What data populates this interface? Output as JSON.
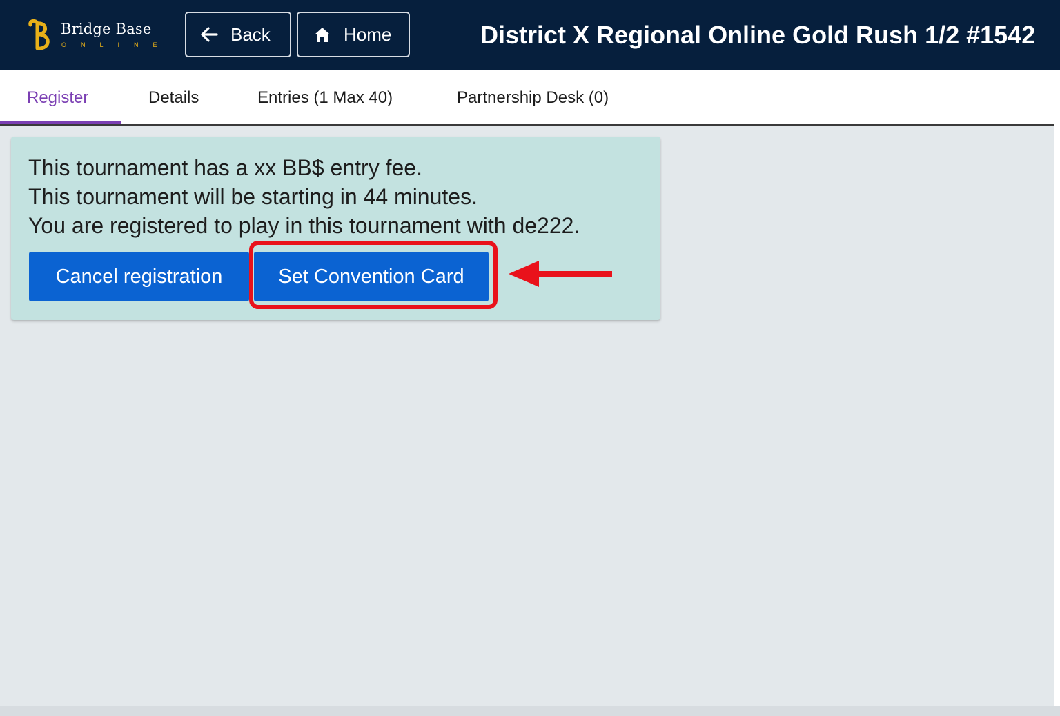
{
  "header": {
    "logo": {
      "name": "Bridge Base",
      "sub": "ONLINE",
      "mark_color": "#e8b019"
    },
    "back_label": "Back",
    "home_label": "Home",
    "title": "District X Regional Online Gold Rush 1/2 #1542",
    "background": "#061f3d"
  },
  "tabs": [
    {
      "label": "Register",
      "active": true
    },
    {
      "label": "Details",
      "active": false
    },
    {
      "label": "Entries (1 Max 40)",
      "active": false
    },
    {
      "label": "Partnership Desk (0)",
      "active": false
    }
  ],
  "panel": {
    "lines": [
      "This tournament has a xx BB$ entry fee.",
      "This tournament will be starting in 44 minutes.",
      "You are registered to play in this tournament with de222."
    ],
    "cancel_label": "Cancel registration",
    "convention_label": "Set Convention Card",
    "background": "#c3e2e0",
    "button_color": "#0b63d2"
  },
  "annotation": {
    "highlight_color": "#e9121b",
    "arrow_icon": "left-arrow-icon"
  },
  "colors": {
    "active_tab": "#7b3fb3",
    "page_background": "#e3e8eb"
  }
}
